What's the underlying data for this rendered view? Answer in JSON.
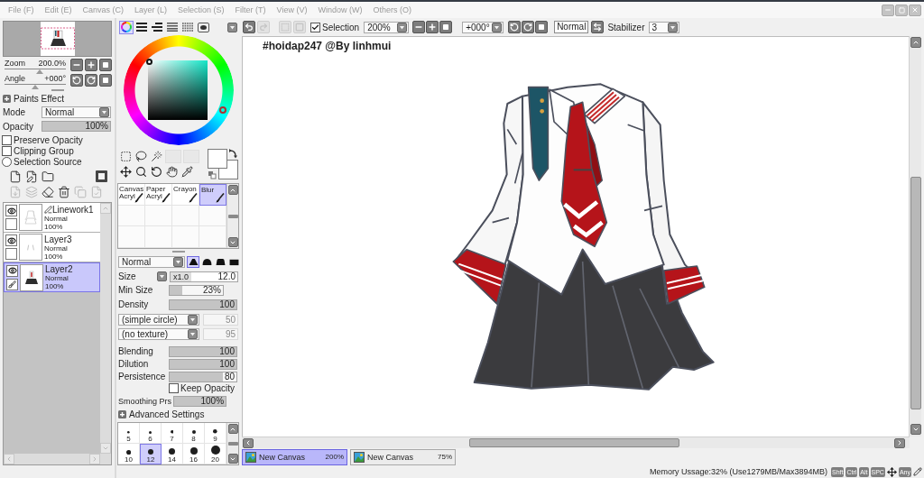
{
  "menu": [
    "File (F)",
    "Edit (E)",
    "Canvas (C)",
    "Layer (L)",
    "Selection (S)",
    "Filter (T)",
    "View (V)",
    "Window (W)",
    "Others (O)"
  ],
  "navigator": {
    "zoom": {
      "label": "Zoom",
      "value": "200.0%",
      "level": 0.57
    },
    "angle": {
      "label": "Angle",
      "value": "+000°",
      "level": 0.5
    }
  },
  "paints_effect": {
    "label": "Paints Effect",
    "expanded": false
  },
  "mode": {
    "label": "Mode",
    "value": "Normal"
  },
  "opacity": {
    "label": "Opacity",
    "value": "100%",
    "level": 1
  },
  "layer_options": [
    {
      "kind": "checkbox",
      "label": "Preserve Opacity",
      "checked": false
    },
    {
      "kind": "checkbox",
      "label": "Clipping Group",
      "checked": false
    },
    {
      "kind": "radio",
      "label": "Selection Source",
      "checked": false
    }
  ],
  "layer_buttons": {
    "row_1": [
      {
        "kind": "new_layer",
        "disabled": false
      },
      {
        "kind": "new_linework",
        "disabled": false
      },
      {
        "kind": "new_folder",
        "disabled": false
      },
      {
        "kind": "mask",
        "disabled": false
      }
    ],
    "row_2": [
      {
        "kind": "transfer",
        "disabled": true
      },
      {
        "kind": "merge",
        "disabled": true
      },
      {
        "kind": "clear",
        "disabled": false
      },
      {
        "kind": "delete",
        "disabled": false
      },
      {
        "kind": "merge_visible",
        "disabled": true
      },
      {
        "kind": "apply_mask",
        "disabled": true
      }
    ]
  },
  "layers": [
    {
      "name": "Linework1",
      "kind": "linework",
      "mode": "Normal",
      "opacity": "100%",
      "visible": true,
      "selected": false
    },
    {
      "name": "Layer3",
      "kind": "raster",
      "mode": "Normal",
      "opacity": "100%",
      "visible": true,
      "selected": false
    },
    {
      "name": "Layer2",
      "kind": "raster",
      "mode": "Normal",
      "opacity": "100%",
      "visible": true,
      "selected": true
    }
  ],
  "color_modes": [
    {
      "kind": "wheel",
      "selected": true
    },
    {
      "kind": "rgb",
      "selected": false
    },
    {
      "kind": "hsv",
      "selected": false
    },
    {
      "kind": "hls",
      "selected": false
    },
    {
      "kind": "swatches",
      "selected": false
    },
    {
      "kind": "scratchpad",
      "selected": false
    }
  ],
  "brushes": [
    {
      "label": "Canvas",
      "sublabel": "Acryl",
      "selected": false
    },
    {
      "label": "Paper",
      "sublabel": "Acryl",
      "selected": false
    },
    {
      "label": "Crayon",
      "selected": false
    },
    {
      "label": "Blur",
      "selected": true
    }
  ],
  "brush": {
    "blend_mode": "Normal",
    "tips": [
      {
        "kind": "peak",
        "selected": true
      },
      {
        "kind": "dome",
        "selected": false
      },
      {
        "kind": "plateau",
        "selected": false
      },
      {
        "kind": "block",
        "selected": false
      }
    ],
    "size": {
      "label": "Size",
      "multiplier": "x1.0",
      "value": "12.0"
    },
    "min_size": {
      "label": "Min Size",
      "value": "23%",
      "level": 0.23
    },
    "density": {
      "label": "Density",
      "value": "100",
      "level": 1
    },
    "shape": {
      "value": "(simple circle)",
      "amount": "50",
      "disabled": true
    },
    "texture": {
      "value": "(no texture)",
      "amount": "95",
      "disabled": true
    },
    "blending": {
      "label": "Blending",
      "value": "100",
      "level": 1
    },
    "dilution": {
      "label": "Dilution",
      "value": "100",
      "level": 1
    },
    "persistence": {
      "label": "Persistence",
      "value": "80",
      "level": 0.8
    },
    "keep_opacity": {
      "label": "Keep Opacity",
      "checked": false
    },
    "smoothing": {
      "label": "Smoothing Prs",
      "value": "100%",
      "level": 1
    },
    "advanced": {
      "label": "Advanced Settings",
      "expanded": false
    },
    "sizes": [
      {
        "label": "5",
        "selected": false
      },
      {
        "label": "6",
        "selected": false
      },
      {
        "label": "7",
        "selected": false
      },
      {
        "label": "8",
        "selected": false
      },
      {
        "label": "9",
        "selected": false
      },
      {
        "label": "10",
        "selected": false
      },
      {
        "label": "12",
        "selected": true
      },
      {
        "label": "14",
        "selected": false
      },
      {
        "label": "16",
        "selected": false
      },
      {
        "label": "20",
        "selected": false
      }
    ]
  },
  "toolbar": {
    "buttons": [
      {
        "kind": "undo",
        "disabled": false
      },
      {
        "kind": "redo",
        "disabled": true
      },
      {
        "kind": "deselect",
        "disabled": true
      },
      {
        "kind": "invert",
        "disabled": true
      }
    ],
    "selection": {
      "label": "Selection",
      "checked": true
    },
    "zoom": "200%",
    "angle": "+000°",
    "flip_mode": "Normal",
    "stabilizer": {
      "label": "Stabilizer",
      "value": "3"
    }
  },
  "canvas": {
    "caption": "#hoidap247 @By linhmui"
  },
  "canvas_tabs": [
    {
      "title": "New Canvas",
      "zoom": "200%",
      "selected": true
    },
    {
      "title": "New Canvas",
      "zoom": "75%",
      "selected": false
    }
  ],
  "status_bar": {
    "memory": "Memory Ussage:32% (Use1279MB/Max3894MB)",
    "indicators": [
      {
        "kind": "key",
        "label": "Shft"
      },
      {
        "kind": "key",
        "label": "Ctrl"
      },
      {
        "kind": "key",
        "label": "Alt"
      },
      {
        "kind": "key",
        "label": "SPC"
      },
      {
        "kind": "move"
      },
      {
        "kind": "key",
        "label": "Any"
      },
      {
        "kind": "pen"
      }
    ]
  }
}
